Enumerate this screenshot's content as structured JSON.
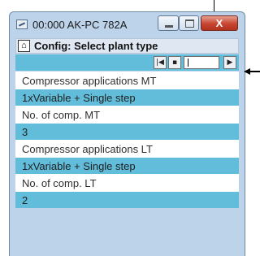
{
  "window": {
    "title": "00:000 AK-PC 782A",
    "close_glyph": "X",
    "minimize_icon": "minimize-icon",
    "maximize_icon": "maximize-icon"
  },
  "header": {
    "title": "Config: Select plant type",
    "home_icon": "home-icon",
    "home_glyph": "⌂"
  },
  "nav": {
    "first_glyph": "|◀",
    "prev_glyph": "▪",
    "next_glyph": "▶"
  },
  "rows": [
    {
      "text": "Compressor applications MT",
      "kind": "label"
    },
    {
      "text": "1xVariable + Single step",
      "kind": "value"
    },
    {
      "text": "No. of comp. MT",
      "kind": "label"
    },
    {
      "text": "3",
      "kind": "value"
    },
    {
      "text": "Compressor applications LT",
      "kind": "label"
    },
    {
      "text": "1xVariable + Single step",
      "kind": "value"
    },
    {
      "text": "No. of comp. LT",
      "kind": "label"
    },
    {
      "text": "2",
      "kind": "value"
    }
  ],
  "colors": {
    "value_row": "#61bdda",
    "window_frame": "#bcd3ea",
    "close_button": "#c74531"
  }
}
